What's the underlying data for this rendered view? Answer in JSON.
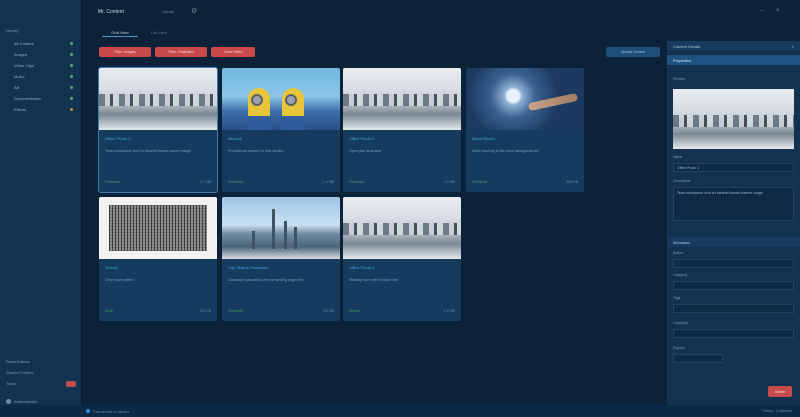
{
  "app": {
    "title": "Mr. Content",
    "subtitle": "Library",
    "colors": {
      "accent": "#2a8fd6",
      "danger": "#c84b4b",
      "success": "#4fa86b"
    }
  },
  "sidebar": {
    "root_label": "Library",
    "items": [
      {
        "label": "All Content",
        "status": "green"
      },
      {
        "label": "Images",
        "status": "green"
      },
      {
        "label": "Video Clips",
        "status": "green"
      },
      {
        "label": "Music",
        "status": "green"
      },
      {
        "label": "Art",
        "status": "green"
      },
      {
        "label": "Documentation",
        "status": "green"
      },
      {
        "label": "Effects",
        "status": "amber"
      }
    ],
    "bottom": [
      {
        "label": "Recent Items"
      },
      {
        "label": "Shared Folders"
      },
      {
        "label": "Trash",
        "badge": true
      }
    ],
    "user": "Administrator"
  },
  "tabs": [
    {
      "label": "Grid View"
    },
    {
      "label": "List View"
    }
  ],
  "filters": [
    {
      "label": "Filter: Images"
    },
    {
      "label": "Filter: Published"
    },
    {
      "label": "Clear Filters"
    }
  ],
  "toolbar": {
    "upload_label": "Upload Content"
  },
  "cards": [
    {
      "title": "Office Photo 1",
      "desc": "Team workspace shot for intranet header banner usage",
      "meta_left": "Published",
      "meta_right": "2.1 MB",
      "thumb": "photo"
    },
    {
      "title": "Minions",
      "desc": "Promotional artwork for kids section",
      "meta_left": "Published",
      "meta_right": "1.4 MB",
      "thumb": "minion"
    },
    {
      "title": "Office Photo 2",
      "desc": "Open plan desk area",
      "meta_left": "Published",
      "meta_right": "2.0 MB",
      "thumb": "photo"
    },
    {
      "title": "Moon Reach",
      "desc": "Hand reaching to the moon background art",
      "meta_left": "Published",
      "meta_right": "880 KB",
      "thumb": "moon"
    },
    {
      "title": "Texture",
      "desc": "Grey noise pattern",
      "meta_left": "Draft",
      "meta_right": "310 KB",
      "thumb": "grid"
    },
    {
      "title": "City Skyline Panorama",
      "desc": "Downtown panoramic view for landing page hero",
      "meta_left": "Published",
      "meta_right": "3.2 MB",
      "thumb": "city"
    },
    {
      "title": "Office Photo 3",
      "desc": "Meeting room with window view",
      "meta_left": "Review",
      "meta_right": "1.9 MB",
      "thumb": "photo"
    }
  ],
  "panel": {
    "title": "Content Details",
    "tab": "Properties",
    "preview_label": "Preview",
    "name_label": "Name",
    "name_value": "Office Photo 1",
    "desc_label": "Description",
    "desc_value": "Team workspace shot for intranet header banner usage",
    "section_meta": "Metadata",
    "fields": [
      {
        "label": "Author",
        "value": ""
      },
      {
        "label": "Category",
        "value": ""
      },
      {
        "label": "Tags",
        "value": ""
      },
      {
        "label": "Copyright",
        "value": ""
      },
      {
        "label": "Expires",
        "value": ""
      }
    ],
    "delete_label": "Delete"
  },
  "status": {
    "text": "Connected to server",
    "right": "7 items · 1 selected"
  }
}
